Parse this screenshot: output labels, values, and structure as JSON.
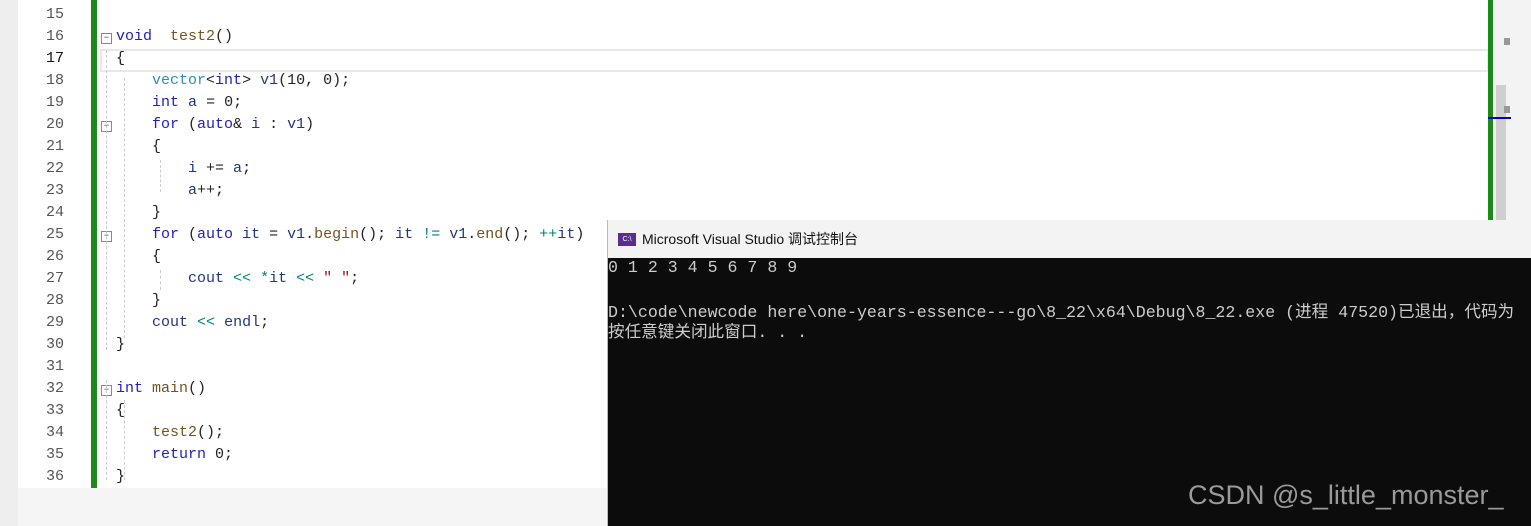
{
  "editor": {
    "line_numbers": [
      "15",
      "16",
      "17",
      "18",
      "19",
      "20",
      "21",
      "22",
      "23",
      "24",
      "25",
      "26",
      "27",
      "28",
      "29",
      "30",
      "31",
      "32",
      "33",
      "34",
      "35",
      "36"
    ],
    "current_line": "17",
    "lines": [
      [],
      [
        [
          "kw",
          "void"
        ],
        [
          "",
          "  "
        ],
        [
          "fn",
          "test2"
        ],
        [
          "",
          "()"
        ]
      ],
      [
        [
          "",
          "{"
        ]
      ],
      [
        [
          "",
          "    "
        ],
        [
          "ty",
          "vector"
        ],
        [
          "",
          "<"
        ],
        [
          "kw",
          "int"
        ],
        [
          "",
          "> "
        ],
        [
          "var",
          "v1"
        ],
        [
          "",
          "(10, 0);"
        ]
      ],
      [
        [
          "",
          "    "
        ],
        [
          "kw",
          "int"
        ],
        [
          "",
          " "
        ],
        [
          "var",
          "a"
        ],
        [
          "",
          " = 0;"
        ]
      ],
      [
        [
          "",
          "    "
        ],
        [
          "kw",
          "for"
        ],
        [
          "",
          " ("
        ],
        [
          "kw",
          "auto"
        ],
        [
          "",
          "& "
        ],
        [
          "var",
          "i"
        ],
        [
          "",
          " : "
        ],
        [
          "var",
          "v1"
        ],
        [
          "",
          ")"
        ]
      ],
      [
        [
          "",
          "    {"
        ]
      ],
      [
        [
          "",
          "        "
        ],
        [
          "var",
          "i"
        ],
        [
          "",
          " += "
        ],
        [
          "var",
          "a"
        ],
        [
          "",
          ";"
        ]
      ],
      [
        [
          "",
          "        "
        ],
        [
          "var",
          "a"
        ],
        [
          "",
          "++;"
        ]
      ],
      [
        [
          "",
          "    }"
        ]
      ],
      [
        [
          "",
          "    "
        ],
        [
          "kw",
          "for"
        ],
        [
          "",
          " ("
        ],
        [
          "kw",
          "auto"
        ],
        [
          "",
          " "
        ],
        [
          "var",
          "it"
        ],
        [
          "",
          " = "
        ],
        [
          "var",
          "v1"
        ],
        [
          "",
          "."
        ],
        [
          "fn",
          "begin"
        ],
        [
          "",
          "(); "
        ],
        [
          "var",
          "it"
        ],
        [
          "",
          " "
        ],
        [
          "op",
          "!="
        ],
        [
          "",
          " "
        ],
        [
          "var",
          "v1"
        ],
        [
          "",
          "."
        ],
        [
          "fn",
          "end"
        ],
        [
          "",
          "(); "
        ],
        [
          "op",
          "++"
        ],
        [
          "var",
          "it"
        ],
        [
          "",
          ")"
        ]
      ],
      [
        [
          "",
          "    {"
        ]
      ],
      [
        [
          "",
          "        "
        ],
        [
          "var",
          "cout"
        ],
        [
          "",
          " "
        ],
        [
          "op",
          "<<"
        ],
        [
          "",
          " "
        ],
        [
          "op",
          "*"
        ],
        [
          "var",
          "it"
        ],
        [
          "",
          " "
        ],
        [
          "op",
          "<<"
        ],
        [
          "",
          " "
        ],
        [
          "str",
          "\" \""
        ],
        [
          "",
          ";"
        ]
      ],
      [
        [
          "",
          "    }"
        ]
      ],
      [
        [
          "",
          "    "
        ],
        [
          "var",
          "cout"
        ],
        [
          "",
          " "
        ],
        [
          "op",
          "<<"
        ],
        [
          "",
          " "
        ],
        [
          "var",
          "endl"
        ],
        [
          "",
          ";"
        ]
      ],
      [
        [
          "",
          "}"
        ]
      ],
      [],
      [
        [
          "kw",
          "int"
        ],
        [
          "",
          " "
        ],
        [
          "fn",
          "main"
        ],
        [
          "",
          "()"
        ]
      ],
      [
        [
          "",
          "{"
        ]
      ],
      [
        [
          "",
          "    "
        ],
        [
          "fn",
          "test2"
        ],
        [
          "",
          "();"
        ]
      ],
      [
        [
          "",
          "    "
        ],
        [
          "kw",
          "return"
        ],
        [
          "",
          " 0;"
        ]
      ],
      [
        [
          "",
          "}"
        ]
      ]
    ]
  },
  "console": {
    "title": "Microsoft Visual Studio 调试控制台",
    "icon": "console-app-icon",
    "output": [
      "0 1 2 3 4 5 6 7 8 9",
      "",
      "D:\\code\\newcode here\\one-years-essence---go\\8_22\\x64\\Debug\\8_22.exe (进程 47520)已退出，代码为",
      "按任意键关闭此窗口. . ."
    ]
  },
  "watermark": "CSDN @s_little_monster_",
  "colors": {
    "keyword": "#2020c0",
    "type": "#2b91af",
    "function": "#74531f",
    "change_bar": "#1a8a1a",
    "console_bg": "#0c0c0c"
  }
}
